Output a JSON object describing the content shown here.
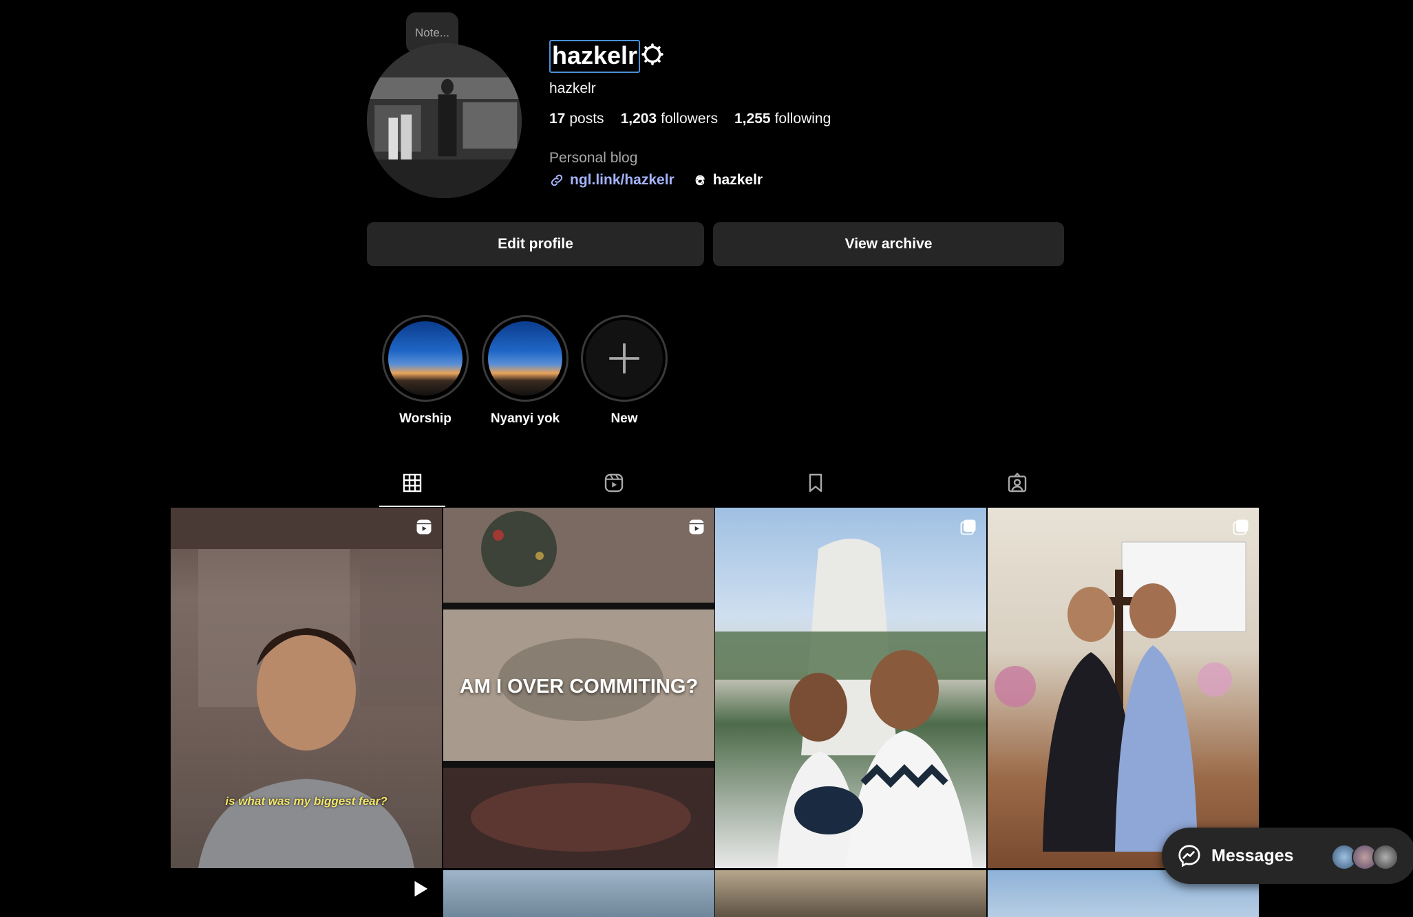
{
  "profile": {
    "note": "Note...",
    "username": "hazkelr",
    "display_name": "hazkelr",
    "posts_count": "17",
    "posts_label": "posts",
    "followers_count": "1,203",
    "followers_label": "followers",
    "following_count": "1,255",
    "following_label": "following",
    "category": "Personal blog",
    "link": "ngl.link/hazkelr",
    "threads_handle": "hazkelr"
  },
  "buttons": {
    "edit_profile": "Edit profile",
    "view_archive": "View archive"
  },
  "highlights": [
    {
      "label": "Worship"
    },
    {
      "label": "Nyanyi yok"
    },
    {
      "label": "New"
    }
  ],
  "tabs": [
    "posts-grid-icon",
    "reels-icon",
    "saved-icon",
    "tagged-icon"
  ],
  "posts": {
    "p1_caption": "is what was my biggest fear?",
    "p2_title": "AM I OVER COMMITING?"
  },
  "messages": {
    "label": "Messages"
  },
  "colors": {
    "background": "#000000",
    "button": "#262626",
    "link": "#a5b4fc",
    "caption": "#f5e66a"
  }
}
